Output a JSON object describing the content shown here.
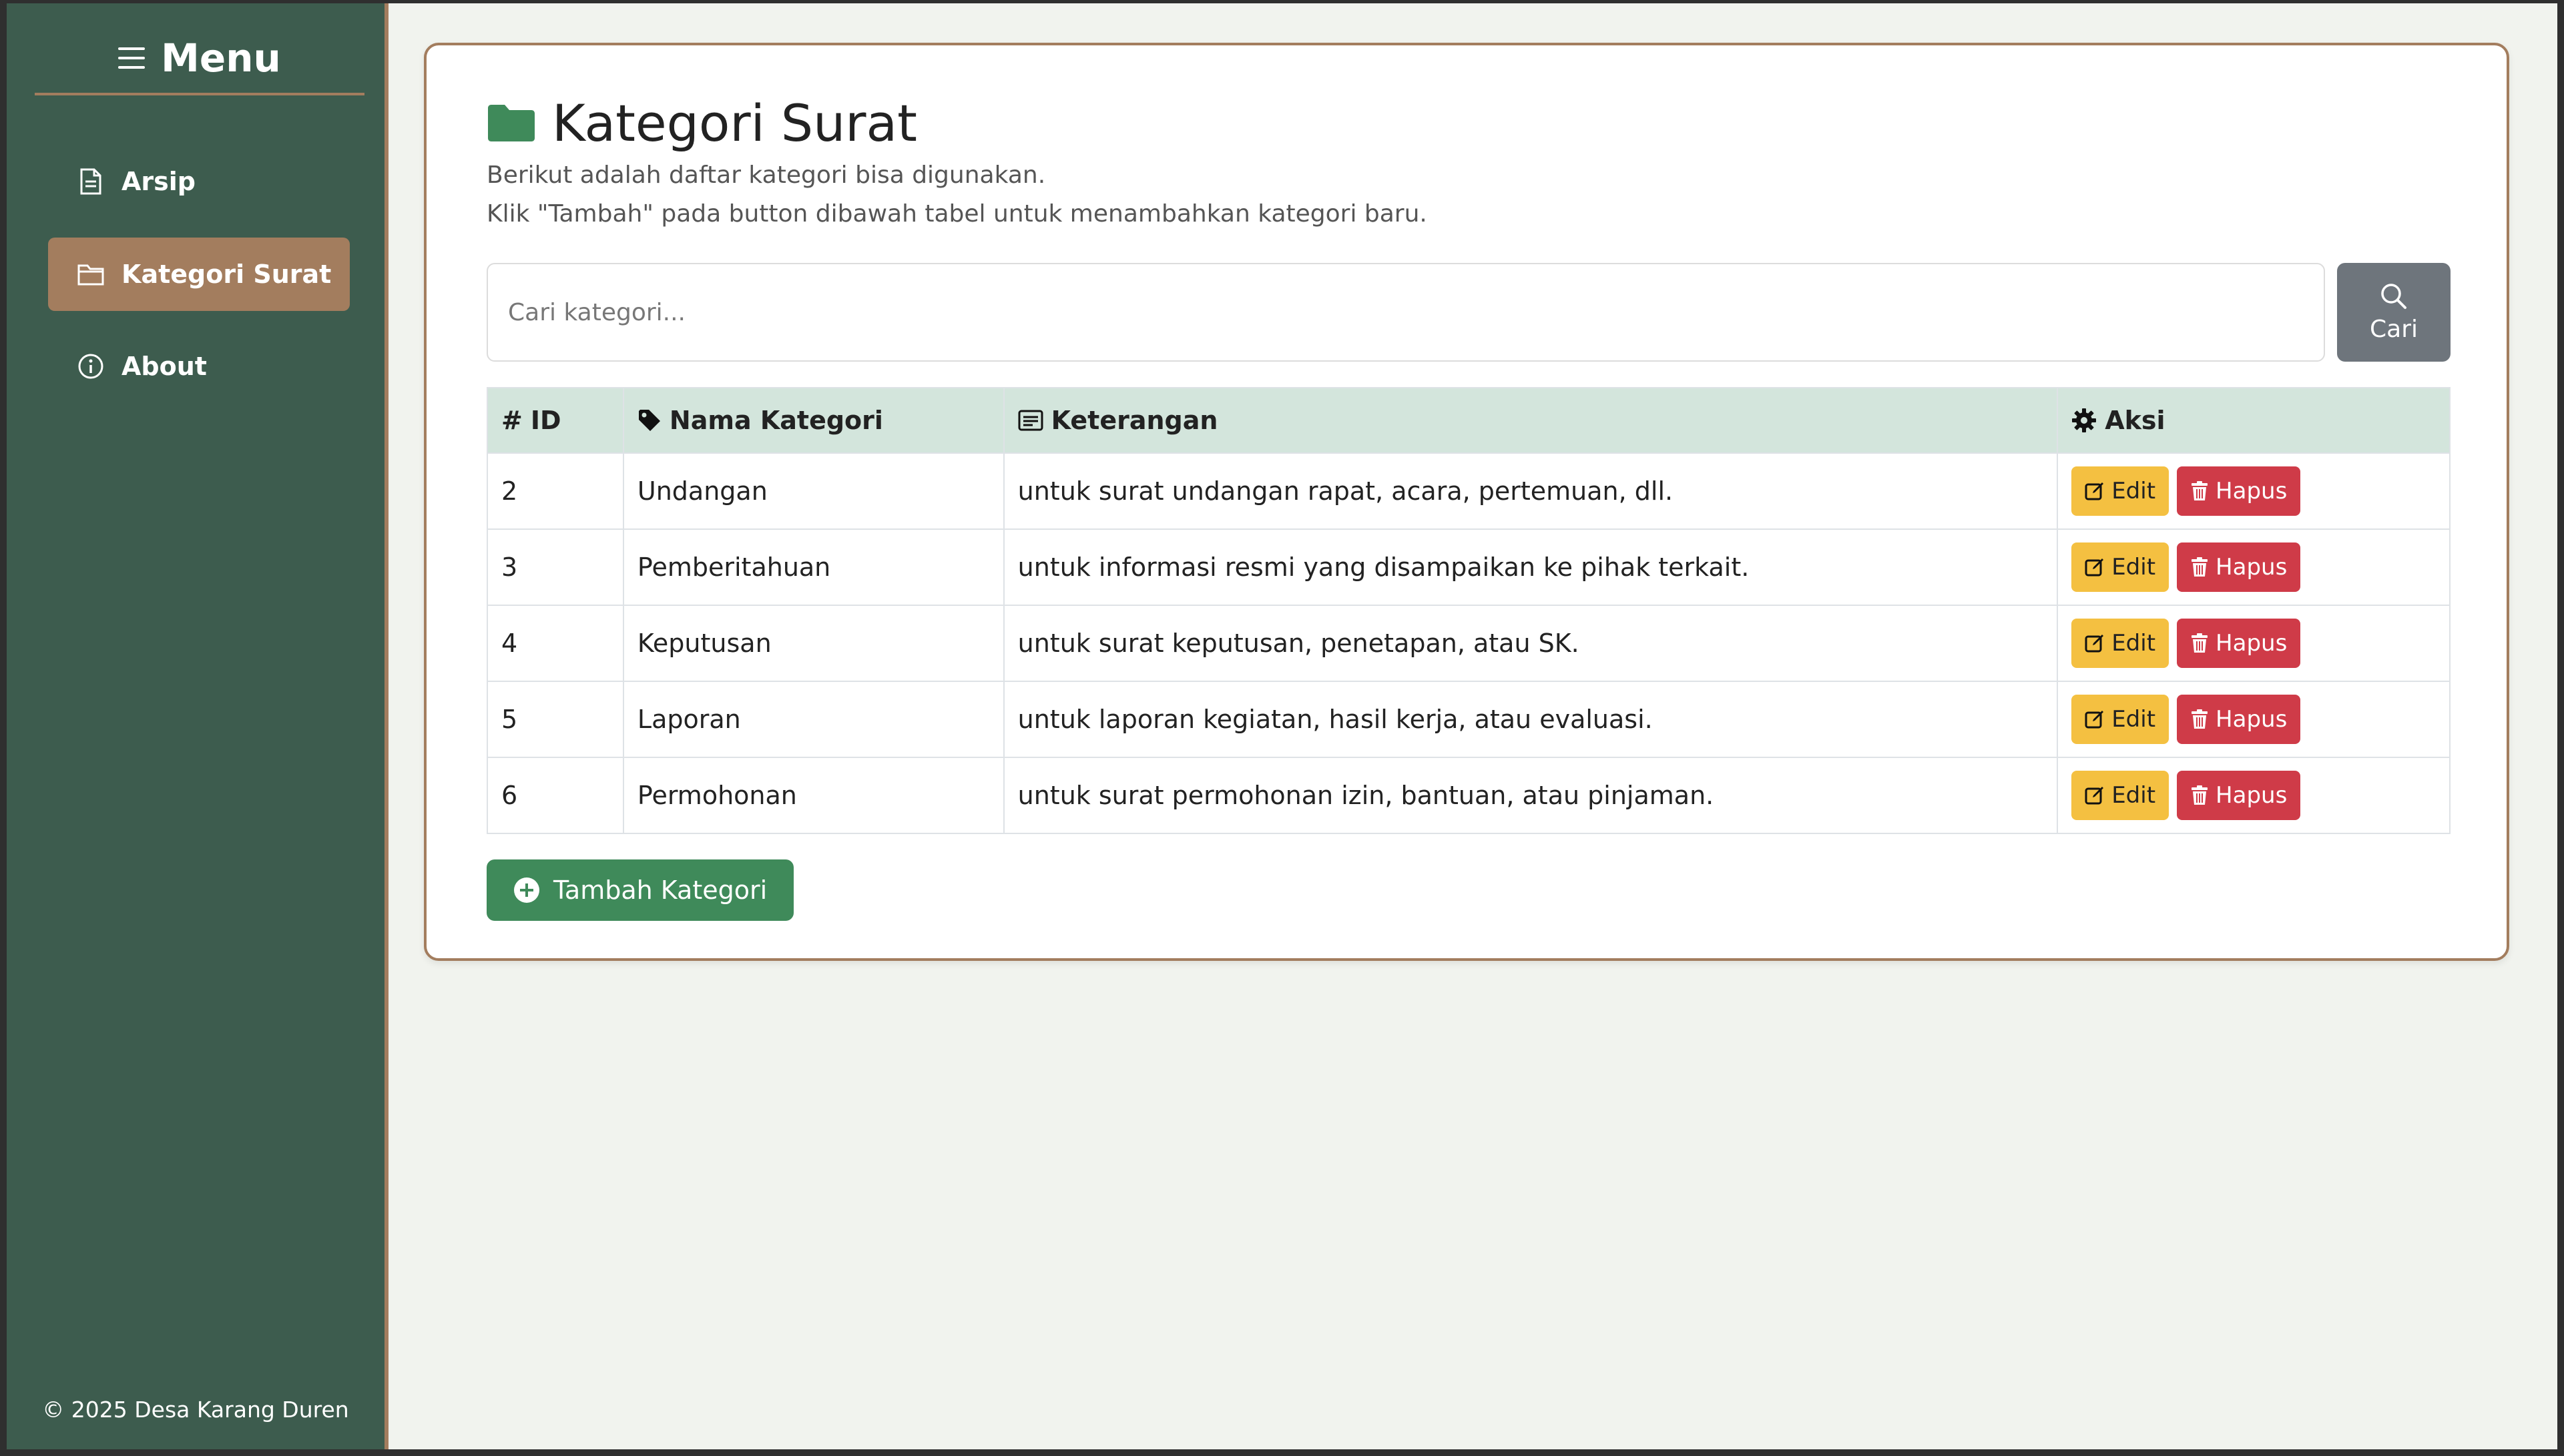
{
  "sidebar": {
    "title": "Menu",
    "items": [
      {
        "label": "Arsip",
        "icon": "file-text-icon",
        "active": false
      },
      {
        "label": "Kategori Surat",
        "icon": "folder-icon",
        "active": true
      },
      {
        "label": "About",
        "icon": "info-icon",
        "active": false
      }
    ],
    "footer": "© 2025 Desa Karang Duren"
  },
  "main": {
    "title": "Kategori Surat",
    "description_line1": "Berikut adalah daftar kategori bisa digunakan.",
    "description_line2": "Klik \"Tambah\" pada button dibawah tabel untuk menambahkan kategori baru.",
    "search": {
      "placeholder": "Cari kategori...",
      "value": "",
      "button_label": "Cari"
    },
    "table": {
      "headers": {
        "id": "ID",
        "nama": "Nama Kategori",
        "keterangan": "Keterangan",
        "aksi": "Aksi"
      },
      "id_prefix": "#",
      "rows": [
        {
          "id": "2",
          "nama": "Undangan",
          "keterangan": "untuk surat undangan rapat, acara, pertemuan, dll."
        },
        {
          "id": "3",
          "nama": "Pemberitahuan",
          "keterangan": "untuk informasi resmi yang disampaikan ke pihak terkait."
        },
        {
          "id": "4",
          "nama": "Keputusan",
          "keterangan": "untuk surat keputusan, penetapan, atau SK."
        },
        {
          "id": "5",
          "nama": "Laporan",
          "keterangan": "untuk laporan kegiatan, hasil kerja, atau evaluasi."
        },
        {
          "id": "6",
          "nama": "Permohonan",
          "keterangan": "untuk surat permohonan izin, bantuan, atau pinjaman."
        }
      ],
      "edit_label": "Edit",
      "delete_label": "Hapus"
    },
    "add_button_label": "Tambah Kategori"
  },
  "colors": {
    "sidebar": "#3d5c4e",
    "accent": "#a37d5e",
    "primary_green": "#3f8a5a",
    "edit_yellow": "#f4c041",
    "delete_red": "#cf3b48",
    "search_button_gray": "#6e757c",
    "table_header": "#d3e5dc"
  }
}
